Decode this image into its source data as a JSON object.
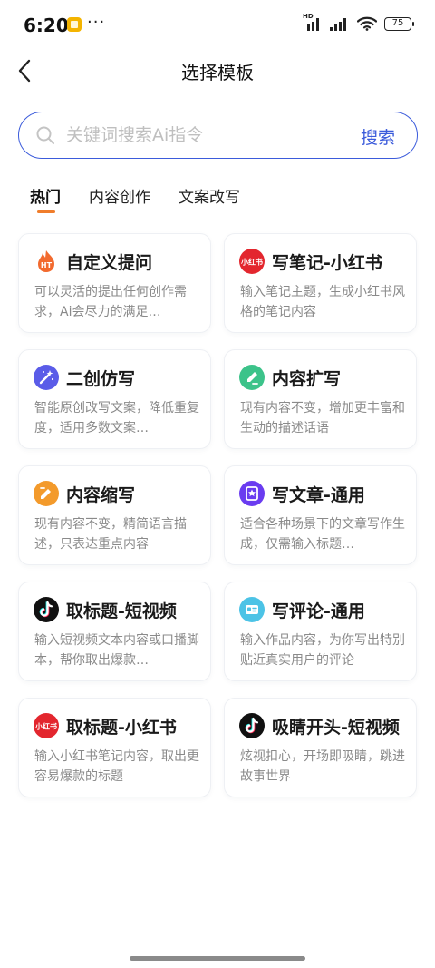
{
  "status_bar": {
    "time": "6:20",
    "more": "···",
    "hd_label": "HD",
    "battery": "75"
  },
  "header": {
    "title": "选择模板"
  },
  "search": {
    "placeholder": "关键词搜索Ai指令",
    "value": "",
    "button_label": "搜索"
  },
  "tabs": [
    {
      "label": "热门",
      "active": true
    },
    {
      "label": "内容创作",
      "active": false
    },
    {
      "label": "文案改写",
      "active": false
    }
  ],
  "colors": {
    "accent": "#3b5bdb",
    "tab_indicator": "#f07d2b"
  },
  "cards": [
    {
      "title": "自定义提问",
      "desc": "可以灵活的提出任何创作需求，Ai会尽力的满足…",
      "icon": "hot-topic-icon",
      "icon_text": "HT"
    },
    {
      "title": "写笔记-小红书",
      "desc": "输入笔记主题，生成小红书风格的笔记内容",
      "icon": "xiaohongshu-icon",
      "icon_text": "小红书"
    },
    {
      "title": "二创仿写",
      "desc": "智能原创改写文案，降低重复度，适用多数文案…",
      "icon": "magic-wand-icon"
    },
    {
      "title": "内容扩写",
      "desc": "现有内容不变，增加更丰富和生动的描述话语",
      "icon": "expand-pen-icon"
    },
    {
      "title": "内容缩写",
      "desc": "现有内容不变，精简语言描述，只表达重点内容",
      "icon": "condense-icon"
    },
    {
      "title": "写文章-通用",
      "desc": "适合各种场景下的文章写作生成，仅需输入标题…",
      "icon": "star-document-icon"
    },
    {
      "title": "取标题-短视频",
      "desc": "输入短视频文本内容或口播脚本，帮你取出爆款…",
      "icon": "tiktok-icon"
    },
    {
      "title": "写评论-通用",
      "desc": "输入作品内容，为你写出特别贴近真实用户的评论",
      "icon": "comment-card-icon"
    },
    {
      "title": "取标题-小红书",
      "desc": "输入小红书笔记内容，取出更容易爆款的标题",
      "icon": "xiaohongshu-icon",
      "icon_text": "小红书"
    },
    {
      "title": "吸睛开头-短视频",
      "desc": "炫视扣心，开场即吸睛，跳进故事世界",
      "icon": "tiktok-icon"
    }
  ]
}
